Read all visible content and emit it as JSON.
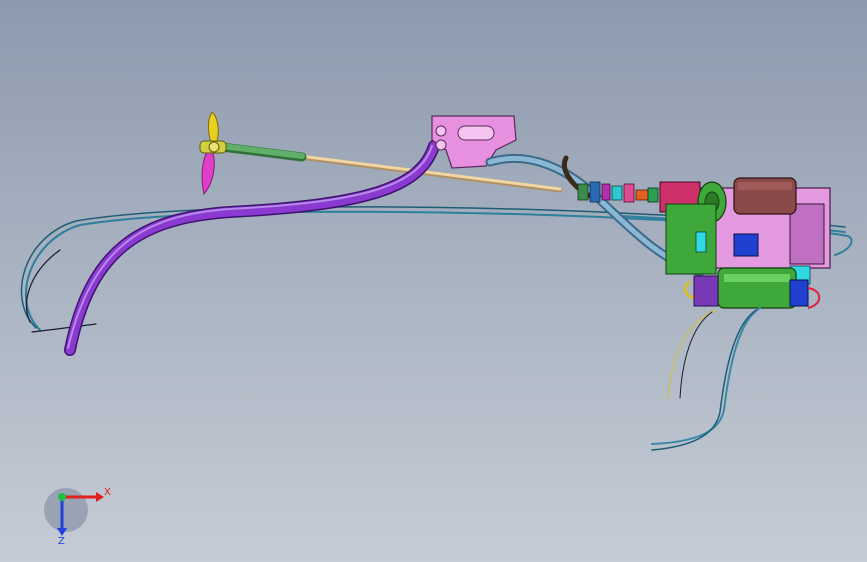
{
  "viewport": {
    "background_top": "#8d9aae",
    "background_bottom": "#c6ccd6"
  },
  "model": {
    "parts": {
      "propeller": {
        "color": "#e040c8",
        "hub_color": "#e8d020"
      },
      "shaft": {
        "color": "#e8c890"
      },
      "shaft_sleeve": {
        "color": "#4f9a5a"
      },
      "mount_bracket": {
        "color": "#e890e0"
      },
      "hose_purple": {
        "color": "#7a2ab8"
      },
      "hose_blue": {
        "color": "#6f9fc0"
      },
      "motor_housing": {
        "color": "#e49ae0"
      },
      "motor_green": {
        "color": "#3fa83a"
      },
      "battery_box": {
        "color": "#8b4a4a"
      },
      "cable_teal": {
        "color": "#3a8aa8"
      },
      "cable_yellow": {
        "color": "#d8d060"
      },
      "connector_red": {
        "color": "#e02040"
      },
      "component_blue": {
        "color": "#2040d0"
      },
      "component_cyan": {
        "color": "#30d8e0"
      }
    }
  },
  "triad": {
    "x_label": "X",
    "z_label": "Z",
    "x_color": "#e02020",
    "y_color": "#20c040",
    "z_color": "#2040e0"
  }
}
